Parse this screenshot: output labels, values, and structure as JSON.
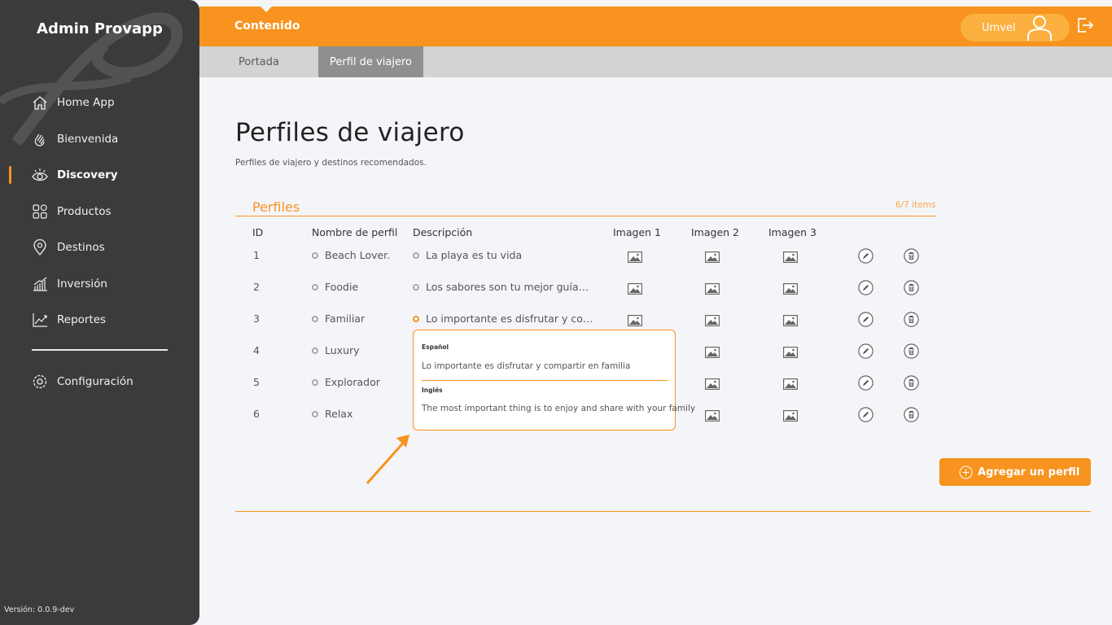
{
  "sidebar": {
    "brand": "Admin Provapp",
    "items": [
      {
        "label": "Home App",
        "icon": "home-icon"
      },
      {
        "label": "Bienvenida",
        "icon": "wave-hand-icon"
      },
      {
        "label": "Discovery",
        "icon": "eye-icon",
        "active": true
      },
      {
        "label": "Productos",
        "icon": "grid-icon"
      },
      {
        "label": "Destinos",
        "icon": "location-pin-icon"
      },
      {
        "label": "Inversión",
        "icon": "bar-chart-icon"
      },
      {
        "label": "Reportes",
        "icon": "line-chart-icon"
      }
    ],
    "settings": {
      "label": "Configuración",
      "icon": "gear-icon"
    },
    "version": "Versión: 0.0.9-dev"
  },
  "header": {
    "section": "Contenido",
    "user": "Umvel"
  },
  "tabs": [
    {
      "label": "Portada",
      "active": false
    },
    {
      "label": "Perfil de viajero",
      "active": true
    }
  ],
  "page": {
    "title": "Perfiles de viajero",
    "subtitle": "Perfiles de viajero y destinos recomendados.",
    "panel_title": "Perfiles",
    "items_count": "6/7 items",
    "add_button": "Agregar un perfil"
  },
  "table": {
    "headers": {
      "id": "ID",
      "name": "Nombre de perfil",
      "description": "Descripción",
      "image1": "Imagen 1",
      "image2": "Imagen 2",
      "image3": "Imagen 3"
    },
    "rows": [
      {
        "id": "1",
        "name": "Beach Lover.",
        "description": "La playa es tu vida"
      },
      {
        "id": "2",
        "name": "Foodie",
        "description": "Los sabores son tu mejor guía…"
      },
      {
        "id": "3",
        "name": "Familiar",
        "description": "Lo importante es disfrutar y co…"
      },
      {
        "id": "4",
        "name": "Luxury",
        "description": ""
      },
      {
        "id": "5",
        "name": "Explorador",
        "description": ""
      },
      {
        "id": "6",
        "name": "Relax",
        "description": ""
      }
    ]
  },
  "tooltip": {
    "lang_es": "Español",
    "text_es": "Lo importante es disfrutar y compartir en familia",
    "lang_en": "Inglés",
    "text_en": "The most important thing is to enjoy and share with your family"
  },
  "colors": {
    "accent": "#f7931e",
    "sidebar": "#3b3b3b",
    "tab_active": "#8f8f8f"
  }
}
